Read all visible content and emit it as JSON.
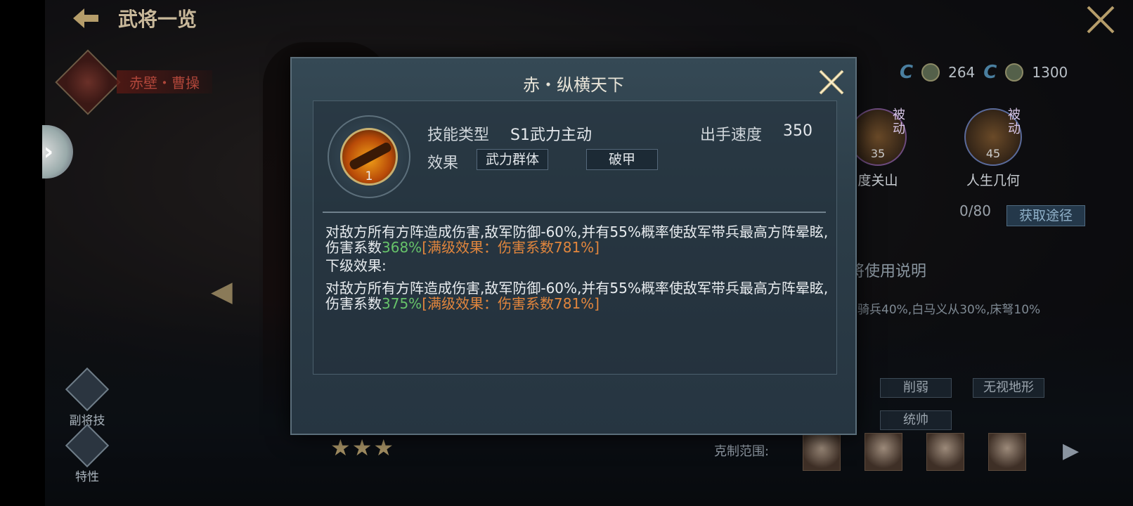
{
  "header": {
    "title": "武将一览"
  },
  "hero": {
    "name": "赤壁・曹操"
  },
  "left_menu": [
    {
      "label": "副将技"
    },
    {
      "label": "特性"
    }
  ],
  "right_panel": {
    "resources": [
      {
        "value": "264"
      },
      {
        "value": "1300"
      }
    ],
    "skills": [
      {
        "name": "度关山",
        "level": "35",
        "badge": "被动"
      },
      {
        "name": "人生几何",
        "level": "45",
        "badge": "被动"
      }
    ],
    "progress": "0/80",
    "obtain_label": "获取途径",
    "usage_title": "将使用说明",
    "usage_text": "骑兵40%,白马义从30%,床弩10%",
    "tags": [
      "削弱",
      "无视地形",
      "统帅"
    ],
    "counter_label": "克制范围:"
  },
  "popup": {
    "title": "赤・纵横天下",
    "skill_level": "1",
    "type_label": "技能类型",
    "type_value": "S1武力主动",
    "speed_label": "出手速度",
    "speed_value": "350",
    "effect_label": "效果",
    "effects": [
      "武力群体",
      "破甲"
    ],
    "current": {
      "text": "对敌方所有方阵造成伤害,敌军防御-60%,并有55%概率使敌军带兵最高方阵晕眩,伤害系数",
      "coef": "368%",
      "max": "[满级效果：伤害系数781%]"
    },
    "next_label": "下级效果:",
    "next": {
      "text": "对敌方所有方阵造成伤害,敌军防御-60%,并有55%概率使敌军带兵最高方阵晕眩,伤害系数",
      "coef": "375%",
      "max": "[满级效果：伤害系数781%]"
    }
  },
  "stars": "★★★",
  "colors": {
    "accent_gold": "#c8b070",
    "green": "#67c36a",
    "orange": "#e2863d"
  }
}
